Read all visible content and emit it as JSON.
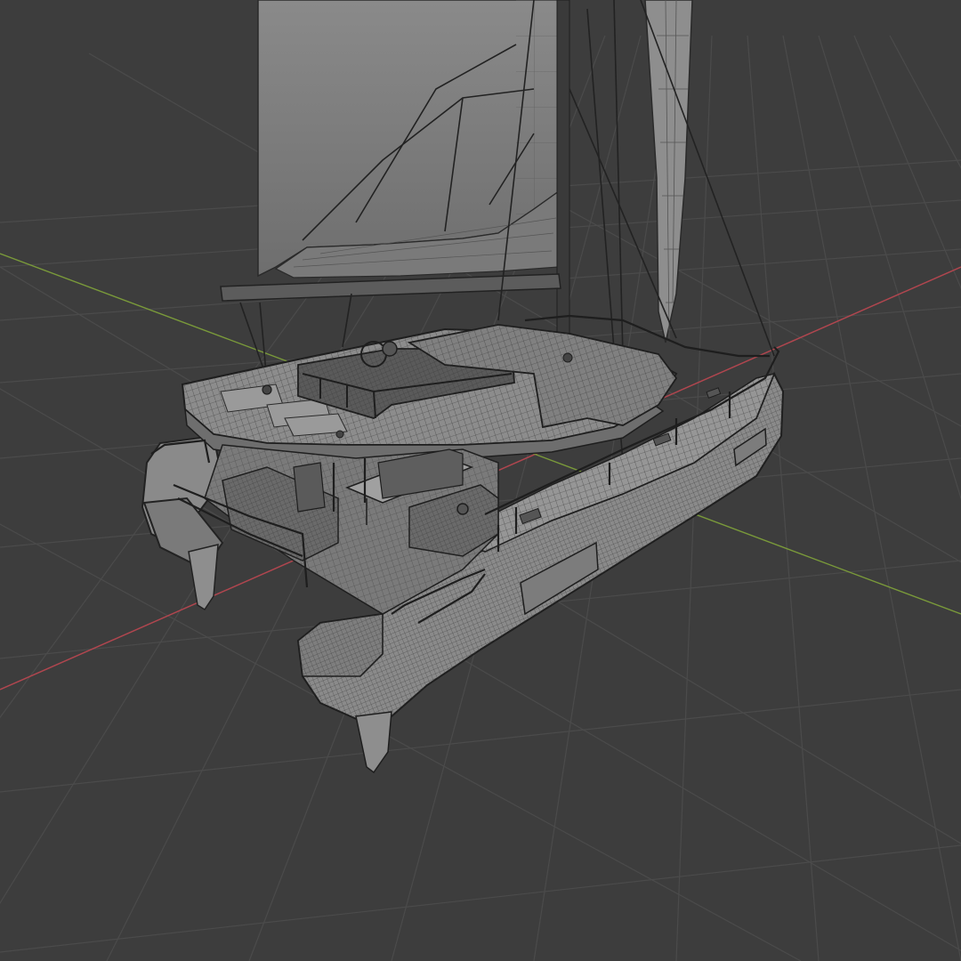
{
  "viewport": {
    "background": "#3d3d3d",
    "grid_color": "#4a4a4a",
    "x_axis_color": "#b0464f",
    "y_axis_color": "#7a9a3a",
    "model_fill": "#8e8e8e",
    "model_shade": "#6c6c6c",
    "wire_color": "#2a2a2a",
    "sail_fill": "#9a9a9a"
  },
  "scene": {
    "object_icon": "catamaran-icon",
    "shading_mode": "wireframe-over-solid"
  }
}
